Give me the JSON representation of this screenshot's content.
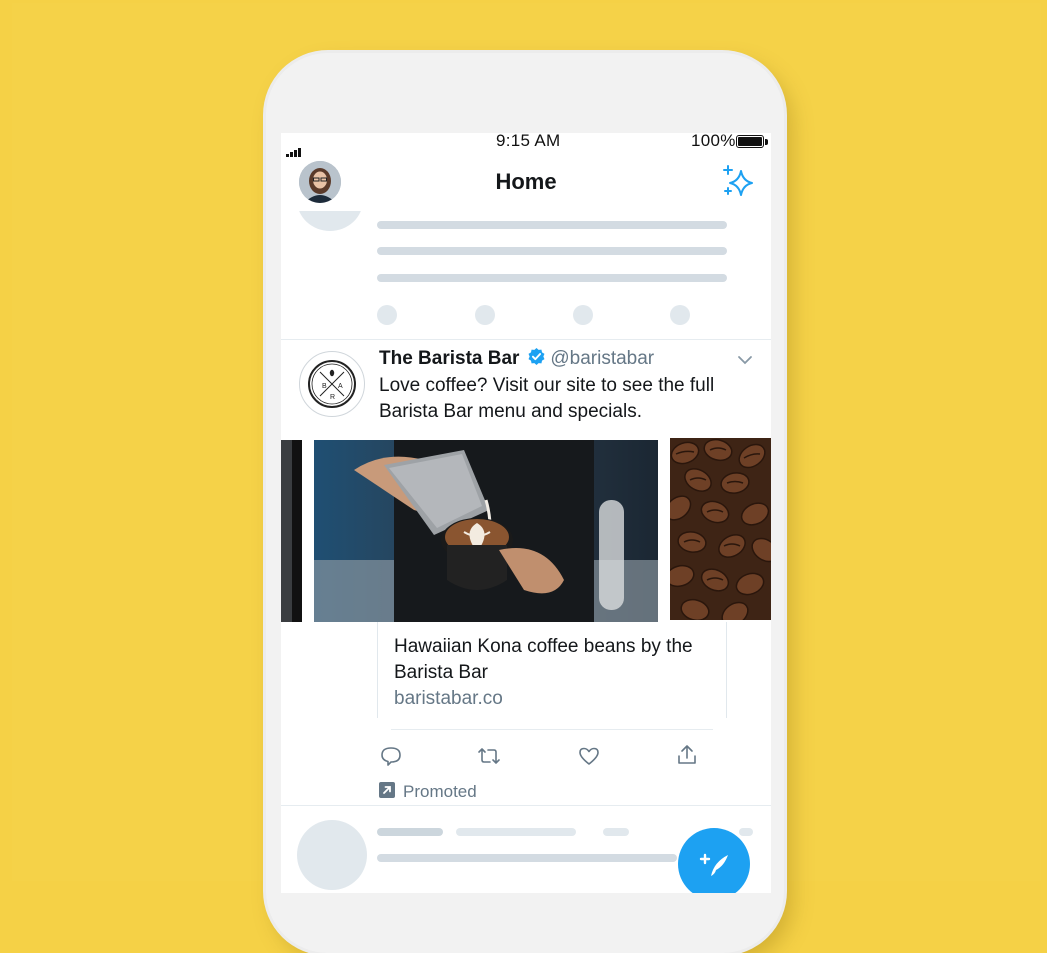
{
  "status_bar": {
    "time": "9:15 AM",
    "battery": "100%"
  },
  "header": {
    "title": "Home",
    "avatar_icon": "user-avatar",
    "sparkle_icon": "sparkle-icon"
  },
  "tweet": {
    "name": "The Barista Bar",
    "handle": "@baristabar",
    "verified": true,
    "text": "Love coffee? Visit our site to see the full Barista Bar menu and specials.",
    "logo_text": "B A R",
    "card": {
      "title": "Hawaiian Kona coffee beans by the Barista Bar",
      "url": "baristabar.co"
    },
    "actions": [
      "reply-icon",
      "retweet-icon",
      "like-icon",
      "share-icon"
    ],
    "promoted_label": "Promoted"
  },
  "colors": {
    "accent": "#1da1f2",
    "background": "#f5d146",
    "muted_text": "#657786",
    "skeleton": "#d3dbe2"
  },
  "compose_icon": "compose-tweet-icon"
}
